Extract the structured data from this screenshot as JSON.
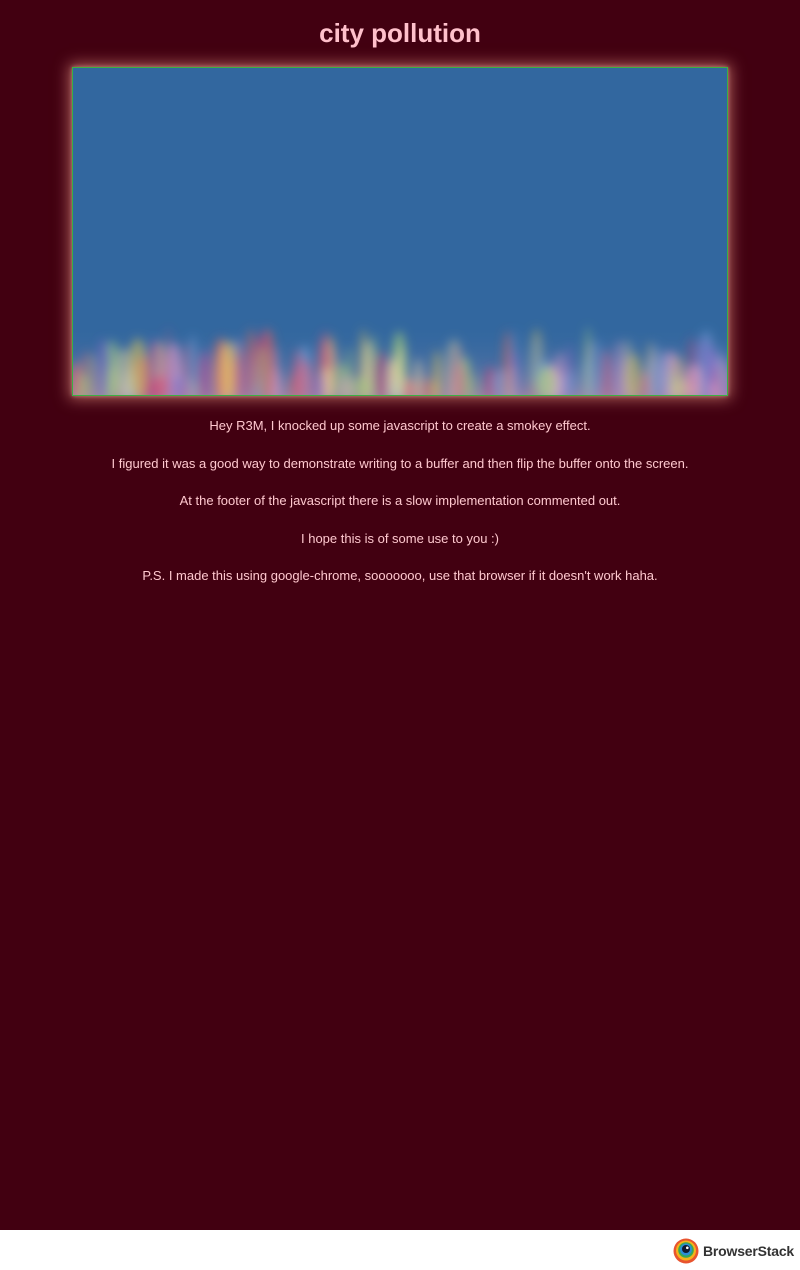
{
  "page": {
    "title": "city pollution"
  },
  "paragraphs": [
    "Hey R3M, I knocked up some javascript to create a smokey effect.",
    "I figured it was a good way to demonstrate writing to a buffer and then flip the buffer onto the screen.",
    "At the footer of the javascript there is a slow implementation commented out.",
    "I hope this is of some use to you :)",
    "P.S. I made this using google-chrome, sooooooo, use that browser if it doesn't work haha."
  ],
  "footer": {
    "brand": "BrowserStack",
    "logo_icon": "browserstack-logo-icon"
  },
  "colors": {
    "background": "#420011",
    "title": "#ffc0cb",
    "text": "#ffc8cf",
    "canvas_sky": "#32679f",
    "canvas_border": "#3cb043",
    "glow": "#ffaa96"
  }
}
